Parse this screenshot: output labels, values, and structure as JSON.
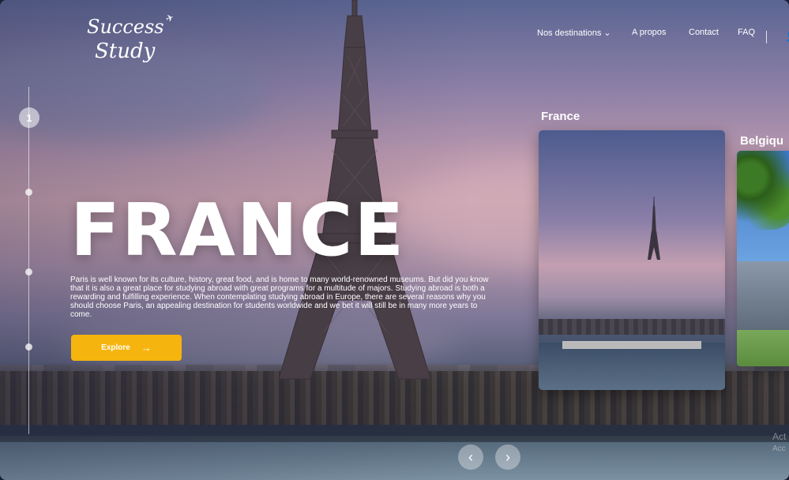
{
  "brand": {
    "logo_line1": "Success",
    "logo_line2": "Study"
  },
  "nav": {
    "items": [
      "Nos destinations",
      "A propos",
      "Contact",
      "FAQ"
    ],
    "dropdown_icon": "chevron-down-icon",
    "user_icon": "user-icon"
  },
  "stepper": {
    "active_step": "1"
  },
  "hero": {
    "title": "FRANCE",
    "description": "Paris is well known for its culture, history, great food, and is home to many world-renowned museums. But did you know that it is also a great place for studying abroad with great programs for a multitude of majors. Studying abroad is both a rewarding and fulfilling experience. When contemplating studying abroad in Europe, there are several reasons why you should choose Paris, an appealing destination for students worldwide and we bet it will still be in many more years to come.",
    "cta_label": "Explore",
    "cta_color": "#f6b40e"
  },
  "cards": [
    {
      "label": "France"
    },
    {
      "label": "Belgiqu"
    }
  ],
  "watermark": {
    "line1": "Act",
    "line2": "Acc"
  }
}
